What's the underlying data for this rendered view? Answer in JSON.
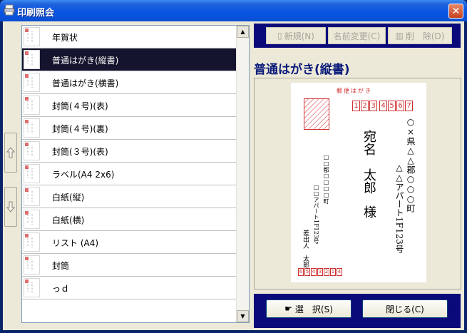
{
  "window": {
    "title": "印刷照会",
    "close_label": "✕"
  },
  "list": {
    "items": [
      {
        "label": "年賀状"
      },
      {
        "label": "普通はがき(縦書)",
        "selected": true
      },
      {
        "label": "普通はがき(横書)"
      },
      {
        "label": "封筒(４号)(表)"
      },
      {
        "label": "封筒(４号)(裏)"
      },
      {
        "label": "封筒(３号)(表)"
      },
      {
        "label": "ラベル(A4 2x6)"
      },
      {
        "label": "白紙(縦)"
      },
      {
        "label": "白紙(横)"
      },
      {
        "label": "リスト (A4)"
      },
      {
        "label": "封筒"
      },
      {
        "label": "っｄ"
      }
    ]
  },
  "toolbar": {
    "new_label": "新規(N)",
    "rename_label": "名前変更(C)",
    "delete_label": "削　除(D)"
  },
  "preview": {
    "title": "普通はがき(縦書)",
    "postcard": {
      "header": "郵便はがき",
      "zip_digits": [
        "1",
        "2",
        "3",
        "4",
        "5",
        "6",
        "7"
      ],
      "recipient_address_1": "○×県△△郡○○○町",
      "recipient_address_2": "△△アパート1F123号",
      "recipient_name_1": "宛名　太郎",
      "recipient_name_2": "様",
      "sender_address_1": "□□都□□□□町",
      "sender_address_2": "□□アパート1F123号",
      "sender_name": "差出人　太郎",
      "sender_zip": "6543214"
    }
  },
  "footer": {
    "select_label": "選　択(S)",
    "close_label": "閉じる(C)"
  },
  "colors": {
    "selected_row": "#14142e",
    "panel": "#0a0a7a",
    "red": "#d03030"
  }
}
